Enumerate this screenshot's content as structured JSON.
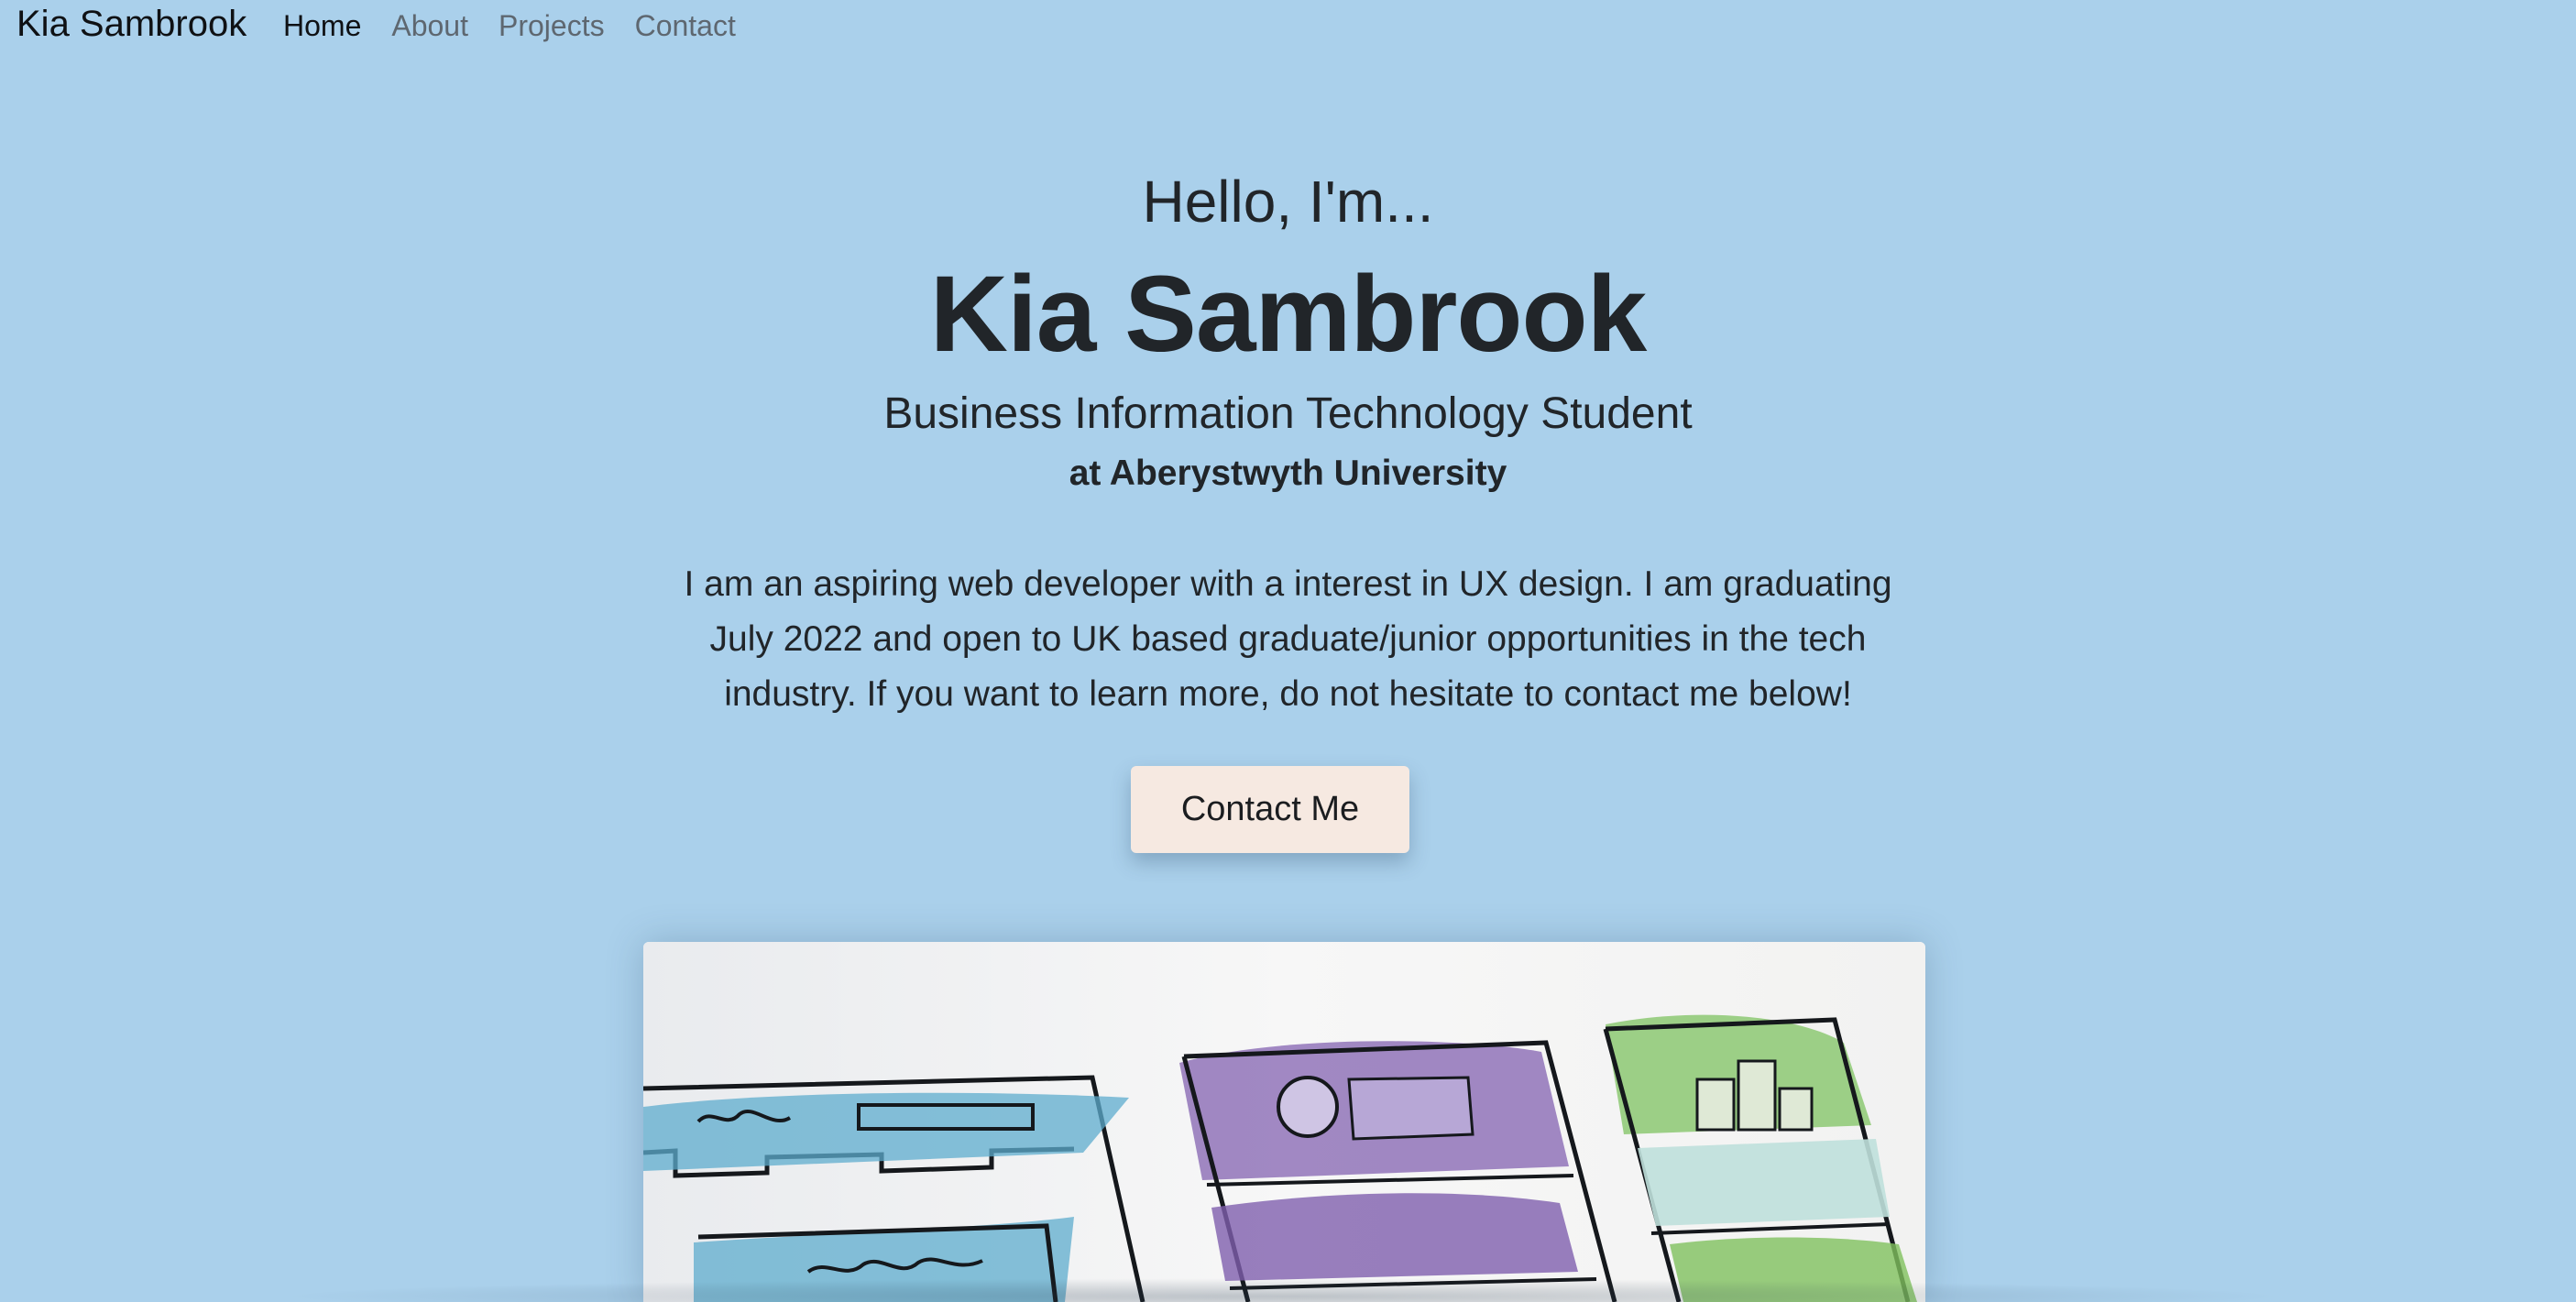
{
  "navbar": {
    "brand": "Kia Sambrook",
    "links": [
      {
        "label": "Home",
        "active": true
      },
      {
        "label": "About",
        "active": false
      },
      {
        "label": "Projects",
        "active": false
      },
      {
        "label": "Contact",
        "active": false
      }
    ]
  },
  "hero": {
    "greeting": "Hello, I'm...",
    "name": "Kia Sambrook",
    "subtitle": "Business Information Technology Student",
    "university": "at Aberystwyth University",
    "intro": "I am an aspiring web developer with a interest in UX design. I am graduating July 2022 and open to UK based graduate/junior opportunities in the tech industry. If you want to learn more, do not hesitate to contact me below!",
    "cta_label": "Contact Me"
  },
  "colors": {
    "background": "#aad0eb",
    "button": "#f6e9e1",
    "text": "#212529"
  }
}
